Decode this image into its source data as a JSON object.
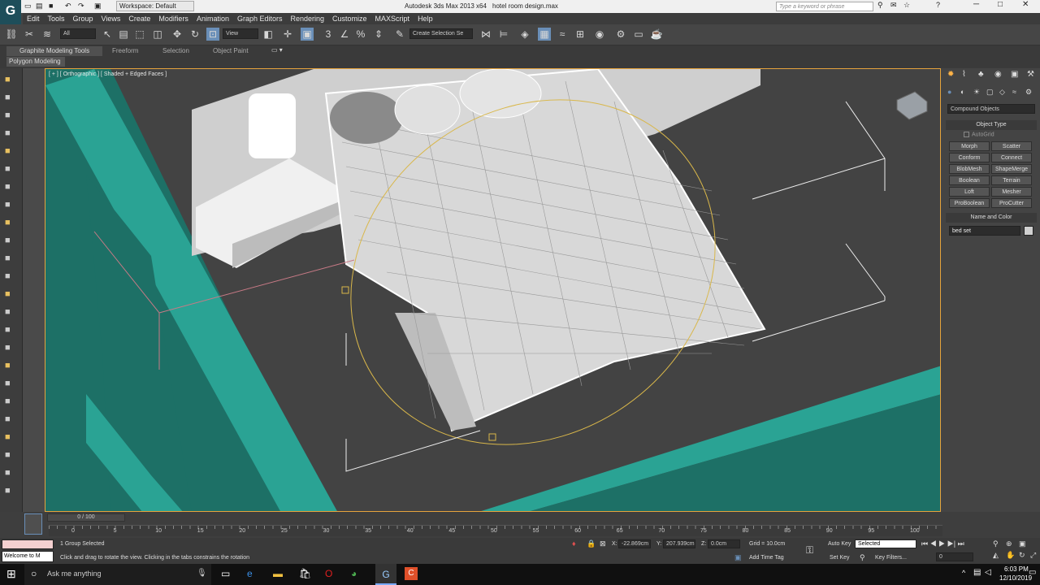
{
  "window": {
    "app_title": "Autodesk 3ds Max  2013 x64",
    "file_name": "hotel room design.max",
    "workspace": "Workspace: Default",
    "search_placeholder": "Type a keyword or phrase"
  },
  "menu": [
    "Edit",
    "Tools",
    "Group",
    "Views",
    "Create",
    "Modifiers",
    "Animation",
    "Graph Editors",
    "Rendering",
    "Customize",
    "MAXScript",
    "Help"
  ],
  "toolbar": {
    "selection_filter": "All",
    "reference_coord": "View",
    "named_selection": "Create Selection Se"
  },
  "ribbon": {
    "tabs": [
      "Graphite Modeling Tools",
      "Freeform",
      "Selection",
      "Object Paint"
    ],
    "sub_tab": "Polygon Modeling"
  },
  "viewport": {
    "label": "[ + ] [ Orthographic ] [ Shaded + Edged Faces ]",
    "colors": {
      "wall": "#2aa394",
      "wall_dark": "#1d7066",
      "floor": "#434343",
      "wire": "#ffffff",
      "gizmo": "#d9b74a"
    }
  },
  "command_panel": {
    "dropdown": "Compound Objects",
    "object_type_title": "Object Type",
    "autogrid": "AutoGrid",
    "buttons": [
      "Morph",
      "Scatter",
      "Conform",
      "Connect",
      "BlobMesh",
      "ShapeMerge",
      "Boolean",
      "Terrain",
      "Loft",
      "Mesher",
      "ProBoolean",
      "ProCutter"
    ],
    "name_color_title": "Name and Color",
    "object_name": "bed set"
  },
  "timeline": {
    "frame": "0 / 100",
    "ticks": [
      "0",
      "5",
      "10",
      "15",
      "20",
      "25",
      "30",
      "35",
      "40",
      "45",
      "50",
      "55",
      "60",
      "65",
      "70",
      "75",
      "80",
      "85",
      "90",
      "95",
      "100"
    ]
  },
  "status": {
    "maxscript": "Welcome to M",
    "selected": "1 Group Selected",
    "prompt": "Click and drag to rotate the view.  Clicking in the tabs constrains the rotation",
    "x_label": "X:",
    "x_value": "-22.869cm",
    "y_label": "Y:",
    "y_value": "207.939cm",
    "z_label": "Z:",
    "z_value": "0.0cm",
    "grid": "Grid = 10.0cm",
    "add_time_tag": "Add Time Tag",
    "auto_key": "Auto Key",
    "set_key": "Set Key",
    "key_mode": "Selected",
    "key_filters": "Key Filters...",
    "current_frame": "0"
  },
  "taskbar": {
    "search": "Ask me anything",
    "time": "6:03 PM",
    "date": "12/10/2019"
  }
}
